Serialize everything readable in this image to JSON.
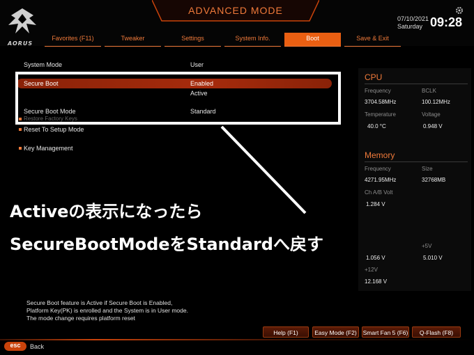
{
  "brand": {
    "logo_text": "AORUS"
  },
  "header": {
    "mode_title": "ADVANCED MODE",
    "date": "07/10/2021",
    "weekday": "Saturday",
    "time": "09:28"
  },
  "tabs": [
    {
      "label": "Favorites (F11)",
      "active": false
    },
    {
      "label": "Tweaker",
      "active": false
    },
    {
      "label": "Settings",
      "active": false
    },
    {
      "label": "System Info.",
      "active": false
    },
    {
      "label": "Boot",
      "active": true
    },
    {
      "label": "Save & Exit",
      "active": false
    }
  ],
  "settings": {
    "system_mode": {
      "label": "System Mode",
      "value": "User"
    },
    "secure_boot": {
      "label": "Secure Boot",
      "value": "Enabled",
      "status": "Active"
    },
    "secure_boot_mode": {
      "label": "Secure Boot Mode",
      "value": "Standard"
    },
    "restore_factory_keys": {
      "label": "Restore Factory Keys"
    },
    "reset_to_setup_mode": {
      "label": "Reset To Setup Mode"
    },
    "key_management": {
      "label": "Key Management"
    }
  },
  "annotation": {
    "line1": "Activeの表示になったら",
    "line2": "SecureBootModeをStandardへ戻す"
  },
  "hardware": {
    "cpu": {
      "title": "CPU",
      "frequency_label": "Frequency",
      "frequency": "3704.58MHz",
      "bclk_label": "BCLK",
      "bclk": "100.12MHz",
      "temperature_label": "Temperature",
      "temperature": "40.0 °C",
      "voltage_label": "Voltage",
      "voltage": "0.948 V"
    },
    "memory": {
      "title": "Memory",
      "frequency_label": "Frequency",
      "frequency": "4271.95MHz",
      "size_label": "Size",
      "size": "32768MB",
      "volt_label": "Ch A/B Volt",
      "volt": "1.284 V"
    },
    "voltage": {
      "v5_label": "+5V",
      "vcore": "1.056 V",
      "v5": "5.010 V",
      "v12_label": "+12V",
      "v12": "12.168 V"
    }
  },
  "help_text": [
    "Secure Boot feature is Active if Secure Boot is Enabled,",
    "Platform Key(PK) is enrolled and the System is in User mode.",
    "The mode change requires platform reset"
  ],
  "footer": {
    "help": "Help (F1)",
    "easy_mode": "Easy Mode (F2)",
    "smart_fan": "Smart Fan 5 (F6)",
    "qflash": "Q-Flash (F8)",
    "esc": "esc",
    "back": "Back"
  },
  "colors": {
    "accent": "#f07a3a",
    "highlight": "#a62b0c",
    "tab_active": "#ea5f12"
  }
}
